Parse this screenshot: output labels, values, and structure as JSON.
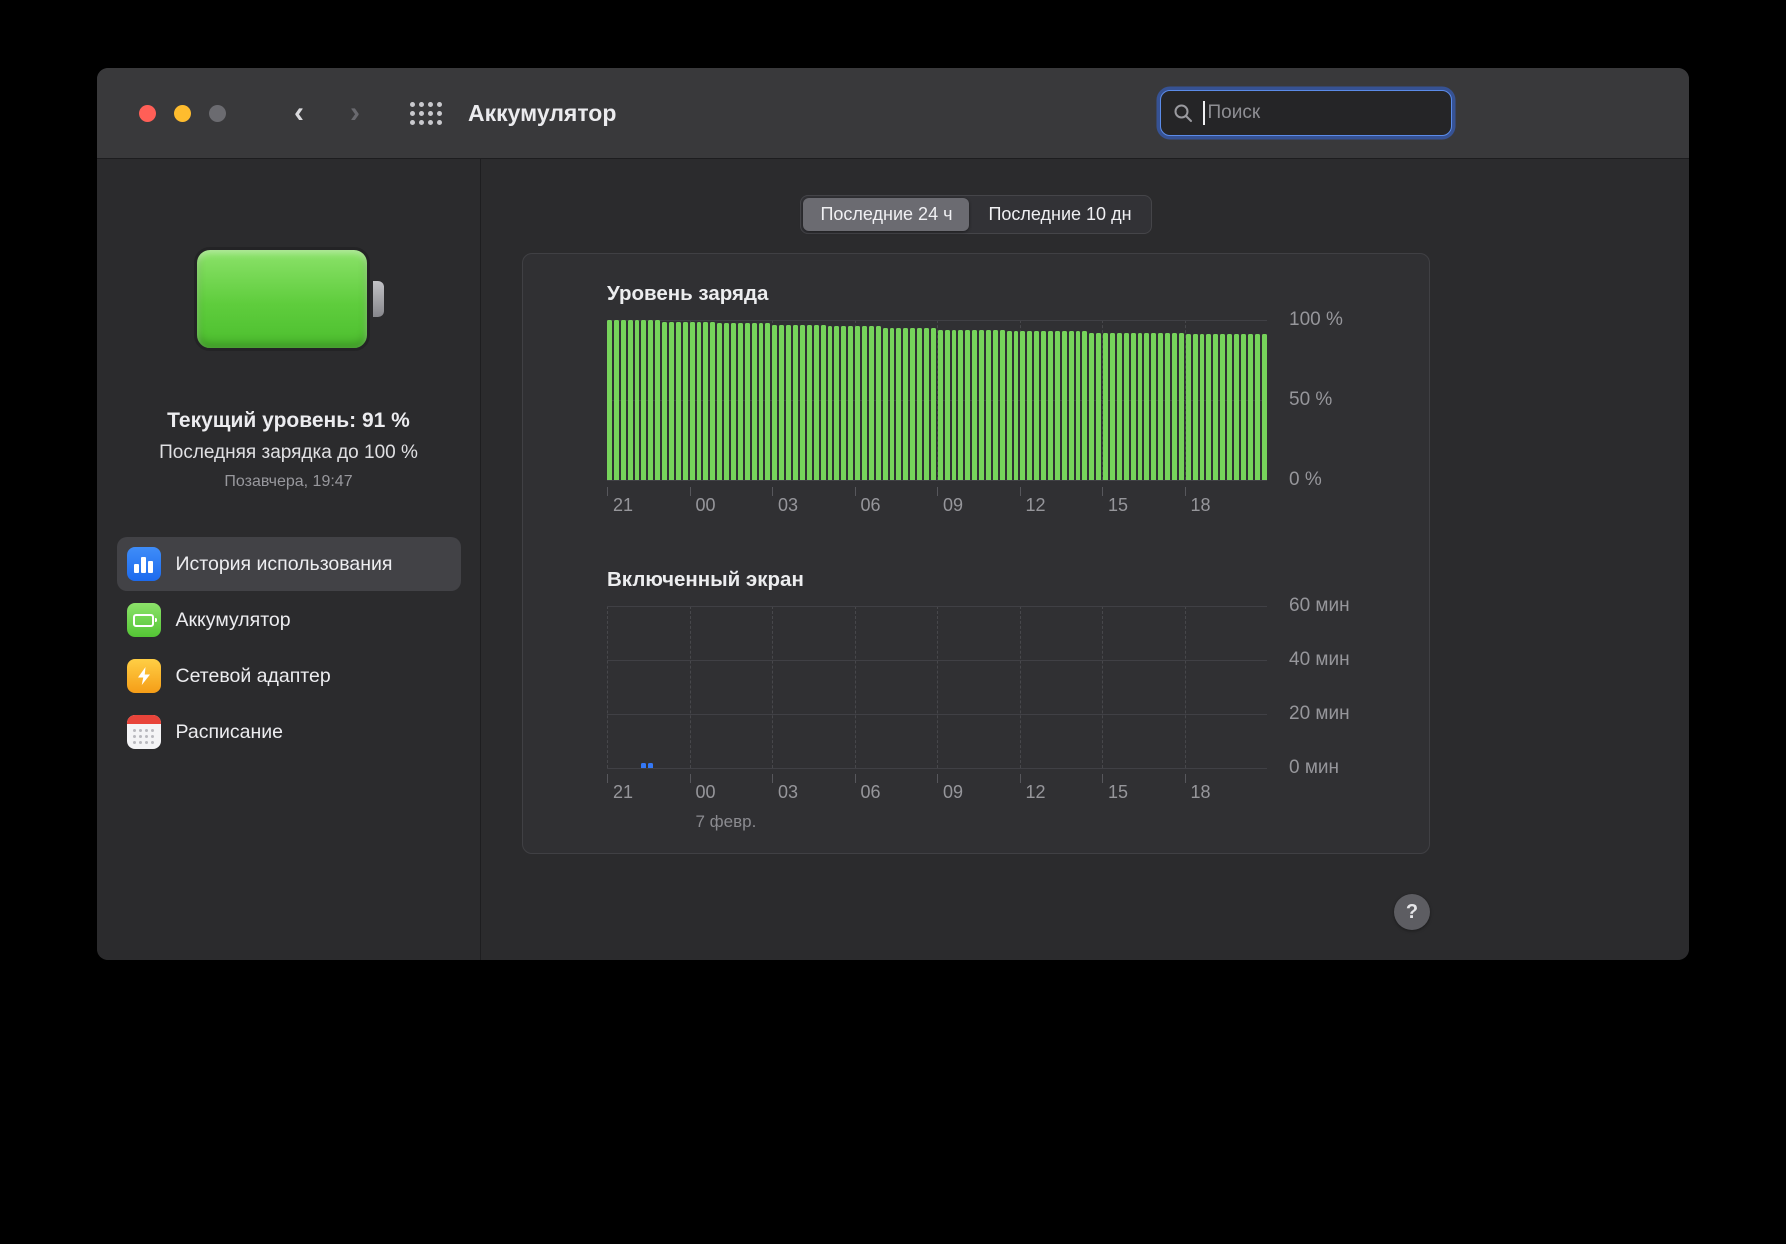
{
  "window": {
    "title": "Аккумулятор",
    "search": {
      "placeholder": "Поиск"
    }
  },
  "sidebar": {
    "summary": {
      "current_level": "Текущий уровень: 91 %",
      "last_charge": "Последняя зарядка до 100 %",
      "last_charge_time": "Позавчера, 19:47"
    },
    "items": [
      {
        "label": "История использования",
        "icon": "usage-history-icon",
        "selected": true
      },
      {
        "label": "Аккумулятор",
        "icon": "battery-icon",
        "selected": false
      },
      {
        "label": "Сетевой адаптер",
        "icon": "power-adapter-icon",
        "selected": false
      },
      {
        "label": "Расписание",
        "icon": "schedule-icon",
        "selected": false
      }
    ]
  },
  "main": {
    "tabs": [
      {
        "label": "Последние 24 ч",
        "selected": true
      },
      {
        "label": "Последние 10 дн",
        "selected": false
      }
    ],
    "help_label": "?"
  },
  "chart_data": [
    {
      "type": "bar",
      "title": "Уровень заряда",
      "ylabel_ticks": [
        "100 %",
        "50 %",
        "0 %"
      ],
      "x_ticks": [
        "21",
        "00",
        "03",
        "06",
        "09",
        "12",
        "15",
        "18"
      ],
      "ylim": [
        0,
        100
      ],
      "bar_color": "#76d35b",
      "bars_per_tick": 12,
      "values": [
        100,
        100,
        100,
        100,
        100,
        100,
        100,
        100,
        99,
        99,
        99,
        99,
        99,
        99,
        99,
        99,
        98,
        98,
        98,
        98,
        98,
        98,
        98,
        98,
        97,
        97,
        97,
        97,
        97,
        97,
        97,
        97,
        96,
        96,
        96,
        96,
        96,
        96,
        96,
        96,
        95,
        95,
        95,
        95,
        95,
        95,
        95,
        95,
        94,
        94,
        94,
        94,
        94,
        94,
        94,
        94,
        94,
        94,
        93,
        93,
        93,
        93,
        93,
        93,
        93,
        93,
        93,
        93,
        93,
        93,
        92,
        92,
        92,
        92,
        92,
        92,
        92,
        92,
        92,
        92,
        92,
        92,
        92,
        92,
        91,
        91,
        91,
        91,
        91,
        91,
        91,
        91,
        91,
        91,
        91,
        91
      ]
    },
    {
      "type": "bar",
      "title": "Включенный экран",
      "ylabel_ticks": [
        "60 мин",
        "40 мин",
        "20 мин",
        "0 мин"
      ],
      "x_ticks": [
        "21",
        "00",
        "03",
        "06",
        "09",
        "12",
        "15",
        "18"
      ],
      "x_sub_label": "7 февр.",
      "ylim": [
        0,
        60
      ],
      "bar_color": "#3478f6",
      "bars_per_tick": 12,
      "values": [
        0,
        0,
        0,
        0,
        0,
        2,
        2,
        0,
        0,
        0,
        0,
        0,
        0,
        0,
        0,
        0,
        0,
        0,
        0,
        0,
        0,
        0,
        0,
        0,
        0,
        0,
        0,
        0,
        0,
        0,
        0,
        0,
        0,
        0,
        0,
        0,
        0,
        0,
        0,
        0,
        0,
        0,
        0,
        0,
        0,
        0,
        0,
        0,
        0,
        0,
        0,
        0,
        0,
        0,
        0,
        0,
        0,
        0,
        0,
        0,
        0,
        0,
        0,
        0,
        0,
        0,
        0,
        0,
        0,
        0,
        0,
        0,
        0,
        0,
        0,
        0,
        0,
        0,
        0,
        0,
        0,
        0,
        0,
        0,
        0,
        0,
        0,
        0,
        0,
        0,
        0,
        0,
        0,
        0,
        0,
        0
      ]
    }
  ]
}
